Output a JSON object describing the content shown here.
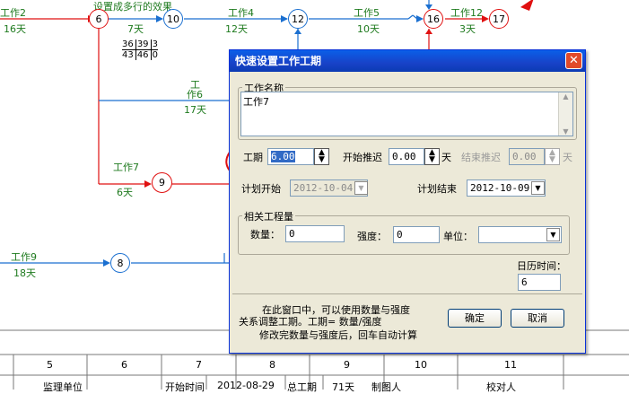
{
  "network": {
    "top_labels": {
      "work2": "工作2",
      "days16": "16天",
      "note": "设置成多行的效果",
      "days7": "7天",
      "work4": "工作4",
      "days12": "12天",
      "work5": "工作5",
      "days10": "10天",
      "work12": "工作12",
      "days3": "3天"
    },
    "nodes": {
      "n6": "6",
      "n10": "10",
      "n12": "12",
      "n16": "16",
      "n17": "17",
      "n9": "9",
      "n8": "8"
    },
    "mini_table": {
      "r1c1": "36",
      "r1c2": "39",
      "r1c3": "3",
      "r2c1": "43",
      "r2c2": "46",
      "r2c3": "0"
    },
    "mid_labels": {
      "work_top": "工",
      "work6": "作6",
      "days17": "17天",
      "work7": "工作7",
      "days6": "6天",
      "work9": "工作9",
      "days18": "18天"
    }
  },
  "bottom_table": {
    "cols": [
      "5",
      "6",
      "7",
      "8",
      "9",
      "10",
      "11"
    ],
    "row": {
      "supervisor": "监理单位",
      "start_time_label": "开始时间",
      "start_time": "2012-08-29",
      "total_period_label": "总工期",
      "total_days": "71天",
      "drafter": "制图人",
      "checker": "校对人"
    }
  },
  "dialog": {
    "title": "快速设置工作工期",
    "close": "✕",
    "task_name_group": "工作名称",
    "task_name_value": "工作7",
    "duration_label": "工期",
    "duration_value": "6.00",
    "start_delay_label": "开始推迟",
    "start_delay_value": "0.00",
    "unit_day": "天",
    "end_delay_label": "结束推迟",
    "end_delay_value": "0.00",
    "plan_start_label": "计划开始",
    "plan_start_value": "2012-10-04",
    "plan_end_label": "计划结束",
    "plan_end_value": "2012-10-09",
    "qty_group": "相关工程量",
    "qty_label": "数量：",
    "qty_value": "0",
    "intensity_label": "强度：",
    "intensity_value": "0",
    "unit_label": "单位：",
    "unit_value": "",
    "calendar_label": "日历时间：",
    "calendar_value": "6",
    "help_line1": "在此窗口中，可以使用数量与强度",
    "help_line2": "关系调整工期。工期= 数量/强度",
    "help_line3": "修改完数量与强度后，回车自动计算",
    "ok": "确定",
    "cancel": "取消"
  },
  "colors": {
    "red": "#e01010",
    "blue": "#1a6fd0",
    "green": "#1e7a1e",
    "title_blue": "#0a5fe8"
  }
}
